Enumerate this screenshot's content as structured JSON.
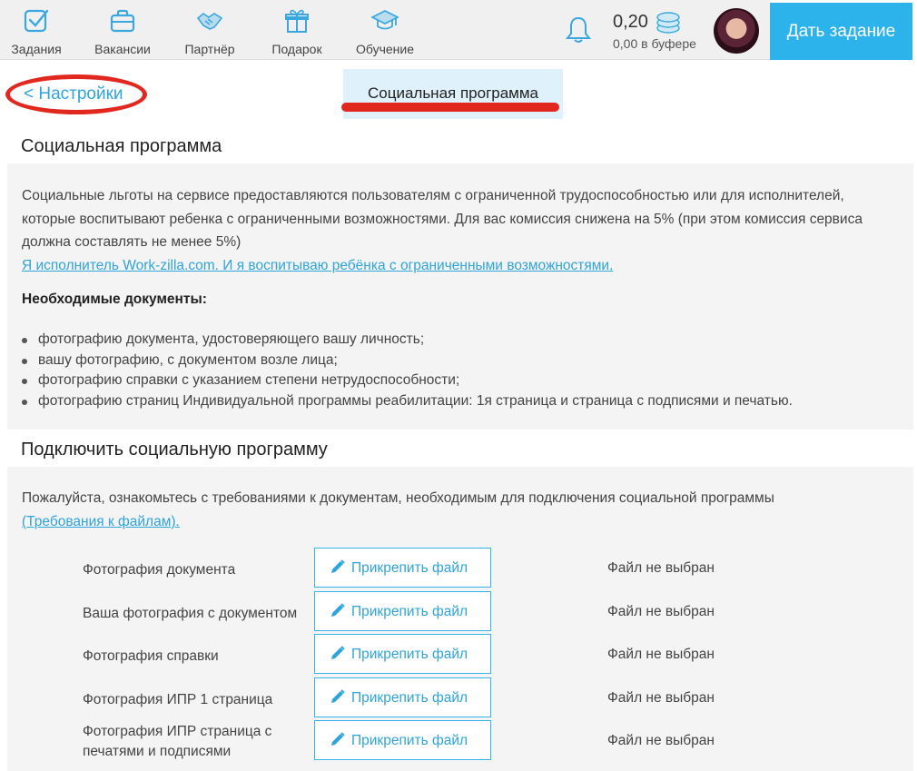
{
  "nav": {
    "items": [
      {
        "label": "Задания",
        "icon": "tasks-icon"
      },
      {
        "label": "Вакансии",
        "icon": "briefcase-icon"
      },
      {
        "label": "Партнёр",
        "icon": "handshake-icon"
      },
      {
        "label": "Подарок",
        "icon": "gift-icon"
      },
      {
        "label": "Обучение",
        "icon": "graduation-cap-icon"
      }
    ],
    "bell_icon": "bell-icon",
    "balance": "0,20",
    "balance_icon": "coins-icon",
    "buffer": "0,00 в буфере",
    "cta_label": "Дать задание"
  },
  "header": {
    "back_label": "< Настройки",
    "active_tab": "Социальная программа"
  },
  "about": {
    "title": "Социальная программа",
    "text": "Социальные льготы на сервисе предоставляются пользователям с ограниченной трудоспособностью или для исполнителей, которые воспитывают ребенка с ограниченными возможностями. Для вас комиссия снижена на 5% (при этом комиссия сервиса должна составлять не менее 5%)",
    "link": "Я исполнитель Work-zilla.com. И я воспитываю ребёнка с ограниченными возможностями.",
    "docs_title": "Необходимые документы:",
    "docs": [
      "фотографию документа, удостоверяющего вашу личность;",
      "вашу фотографию, с документом возле лица;",
      "фотографию справки с указанием степени нетрудоспособности;",
      "фотографию страниц Индивидуальной программы реабилитации: 1я страница и страница с подписями и печатью."
    ]
  },
  "connect": {
    "title": "Подключить социальную программу",
    "text": "Пожалуйста, ознакомьтесь с требованиями к документам, необходимым для подключения социальной программы",
    "link": "(Требования к файлам).",
    "attach_label": "Прикрепить файл",
    "status": "Файл не выбран",
    "rows": [
      {
        "label": "Фотография документа"
      },
      {
        "label": "Ваша фотография с документом"
      },
      {
        "label": "Фотография справки"
      },
      {
        "label": "Фотография ИПР 1 страница"
      },
      {
        "label": "Фотография ИПР страница с печатями и подписями"
      }
    ]
  },
  "colors": {
    "accent": "#2cb3ec",
    "link": "#2fa4da",
    "annotation": "#e0281f",
    "panel": "#f4f4f4"
  }
}
